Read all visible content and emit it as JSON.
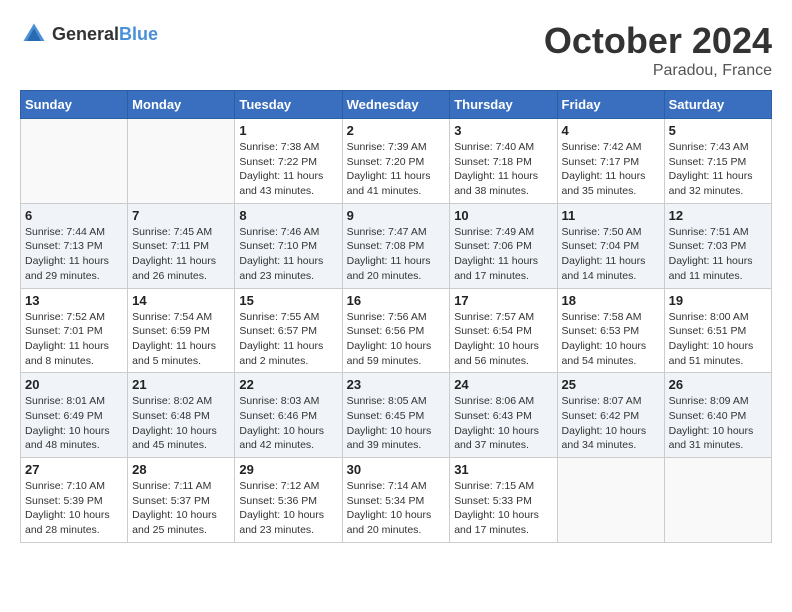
{
  "header": {
    "logo_general": "General",
    "logo_blue": "Blue",
    "month": "October 2024",
    "location": "Paradou, France"
  },
  "days_of_week": [
    "Sunday",
    "Monday",
    "Tuesday",
    "Wednesday",
    "Thursday",
    "Friday",
    "Saturday"
  ],
  "weeks": [
    [
      {
        "day": "",
        "info": ""
      },
      {
        "day": "",
        "info": ""
      },
      {
        "day": "1",
        "info": "Sunrise: 7:38 AM\nSunset: 7:22 PM\nDaylight: 11 hours and 43 minutes."
      },
      {
        "day": "2",
        "info": "Sunrise: 7:39 AM\nSunset: 7:20 PM\nDaylight: 11 hours and 41 minutes."
      },
      {
        "day": "3",
        "info": "Sunrise: 7:40 AM\nSunset: 7:18 PM\nDaylight: 11 hours and 38 minutes."
      },
      {
        "day": "4",
        "info": "Sunrise: 7:42 AM\nSunset: 7:17 PM\nDaylight: 11 hours and 35 minutes."
      },
      {
        "day": "5",
        "info": "Sunrise: 7:43 AM\nSunset: 7:15 PM\nDaylight: 11 hours and 32 minutes."
      }
    ],
    [
      {
        "day": "6",
        "info": "Sunrise: 7:44 AM\nSunset: 7:13 PM\nDaylight: 11 hours and 29 minutes."
      },
      {
        "day": "7",
        "info": "Sunrise: 7:45 AM\nSunset: 7:11 PM\nDaylight: 11 hours and 26 minutes."
      },
      {
        "day": "8",
        "info": "Sunrise: 7:46 AM\nSunset: 7:10 PM\nDaylight: 11 hours and 23 minutes."
      },
      {
        "day": "9",
        "info": "Sunrise: 7:47 AM\nSunset: 7:08 PM\nDaylight: 11 hours and 20 minutes."
      },
      {
        "day": "10",
        "info": "Sunrise: 7:49 AM\nSunset: 7:06 PM\nDaylight: 11 hours and 17 minutes."
      },
      {
        "day": "11",
        "info": "Sunrise: 7:50 AM\nSunset: 7:04 PM\nDaylight: 11 hours and 14 minutes."
      },
      {
        "day": "12",
        "info": "Sunrise: 7:51 AM\nSunset: 7:03 PM\nDaylight: 11 hours and 11 minutes."
      }
    ],
    [
      {
        "day": "13",
        "info": "Sunrise: 7:52 AM\nSunset: 7:01 PM\nDaylight: 11 hours and 8 minutes."
      },
      {
        "day": "14",
        "info": "Sunrise: 7:54 AM\nSunset: 6:59 PM\nDaylight: 11 hours and 5 minutes."
      },
      {
        "day": "15",
        "info": "Sunrise: 7:55 AM\nSunset: 6:57 PM\nDaylight: 11 hours and 2 minutes."
      },
      {
        "day": "16",
        "info": "Sunrise: 7:56 AM\nSunset: 6:56 PM\nDaylight: 10 hours and 59 minutes."
      },
      {
        "day": "17",
        "info": "Sunrise: 7:57 AM\nSunset: 6:54 PM\nDaylight: 10 hours and 56 minutes."
      },
      {
        "day": "18",
        "info": "Sunrise: 7:58 AM\nSunset: 6:53 PM\nDaylight: 10 hours and 54 minutes."
      },
      {
        "day": "19",
        "info": "Sunrise: 8:00 AM\nSunset: 6:51 PM\nDaylight: 10 hours and 51 minutes."
      }
    ],
    [
      {
        "day": "20",
        "info": "Sunrise: 8:01 AM\nSunset: 6:49 PM\nDaylight: 10 hours and 48 minutes."
      },
      {
        "day": "21",
        "info": "Sunrise: 8:02 AM\nSunset: 6:48 PM\nDaylight: 10 hours and 45 minutes."
      },
      {
        "day": "22",
        "info": "Sunrise: 8:03 AM\nSunset: 6:46 PM\nDaylight: 10 hours and 42 minutes."
      },
      {
        "day": "23",
        "info": "Sunrise: 8:05 AM\nSunset: 6:45 PM\nDaylight: 10 hours and 39 minutes."
      },
      {
        "day": "24",
        "info": "Sunrise: 8:06 AM\nSunset: 6:43 PM\nDaylight: 10 hours and 37 minutes."
      },
      {
        "day": "25",
        "info": "Sunrise: 8:07 AM\nSunset: 6:42 PM\nDaylight: 10 hours and 34 minutes."
      },
      {
        "day": "26",
        "info": "Sunrise: 8:09 AM\nSunset: 6:40 PM\nDaylight: 10 hours and 31 minutes."
      }
    ],
    [
      {
        "day": "27",
        "info": "Sunrise: 7:10 AM\nSunset: 5:39 PM\nDaylight: 10 hours and 28 minutes."
      },
      {
        "day": "28",
        "info": "Sunrise: 7:11 AM\nSunset: 5:37 PM\nDaylight: 10 hours and 25 minutes."
      },
      {
        "day": "29",
        "info": "Sunrise: 7:12 AM\nSunset: 5:36 PM\nDaylight: 10 hours and 23 minutes."
      },
      {
        "day": "30",
        "info": "Sunrise: 7:14 AM\nSunset: 5:34 PM\nDaylight: 10 hours and 20 minutes."
      },
      {
        "day": "31",
        "info": "Sunrise: 7:15 AM\nSunset: 5:33 PM\nDaylight: 10 hours and 17 minutes."
      },
      {
        "day": "",
        "info": ""
      },
      {
        "day": "",
        "info": ""
      }
    ]
  ]
}
